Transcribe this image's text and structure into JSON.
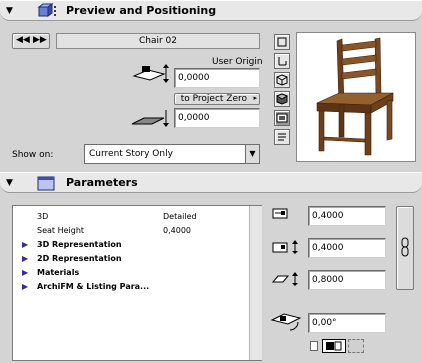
{
  "preview_section": {
    "title": "Preview and Positioning",
    "chair_name": "Chair 02",
    "user_origin_label": "User Origin",
    "user_origin_value": "0,0000",
    "project_zero_label": "to Project Zero",
    "project_zero_value": "0,0000",
    "show_on_label": "Show on:",
    "show_on_value": "Current Story Only"
  },
  "parameters_section": {
    "title": "Parameters",
    "rows": [
      {
        "name": "3D",
        "value": "Detailed",
        "group": false
      },
      {
        "name": "Seat Height",
        "value": "0,4000",
        "group": false
      },
      {
        "name": "3D Representation",
        "value": "",
        "group": true
      },
      {
        "name": "2D Representation",
        "value": "",
        "group": true
      },
      {
        "name": "Materials",
        "value": "",
        "group": true
      },
      {
        "name": "ArchiFM & Listing Para...",
        "value": "",
        "group": true
      }
    ],
    "size_x": "0,4000",
    "size_y": "0,4000",
    "size_z": "0,8000",
    "angle": "0,00°"
  },
  "colors": {
    "header_bg": "#e8e8e8",
    "panel_bg": "#d4d4d4",
    "chair_wood": "#7a4a22"
  }
}
